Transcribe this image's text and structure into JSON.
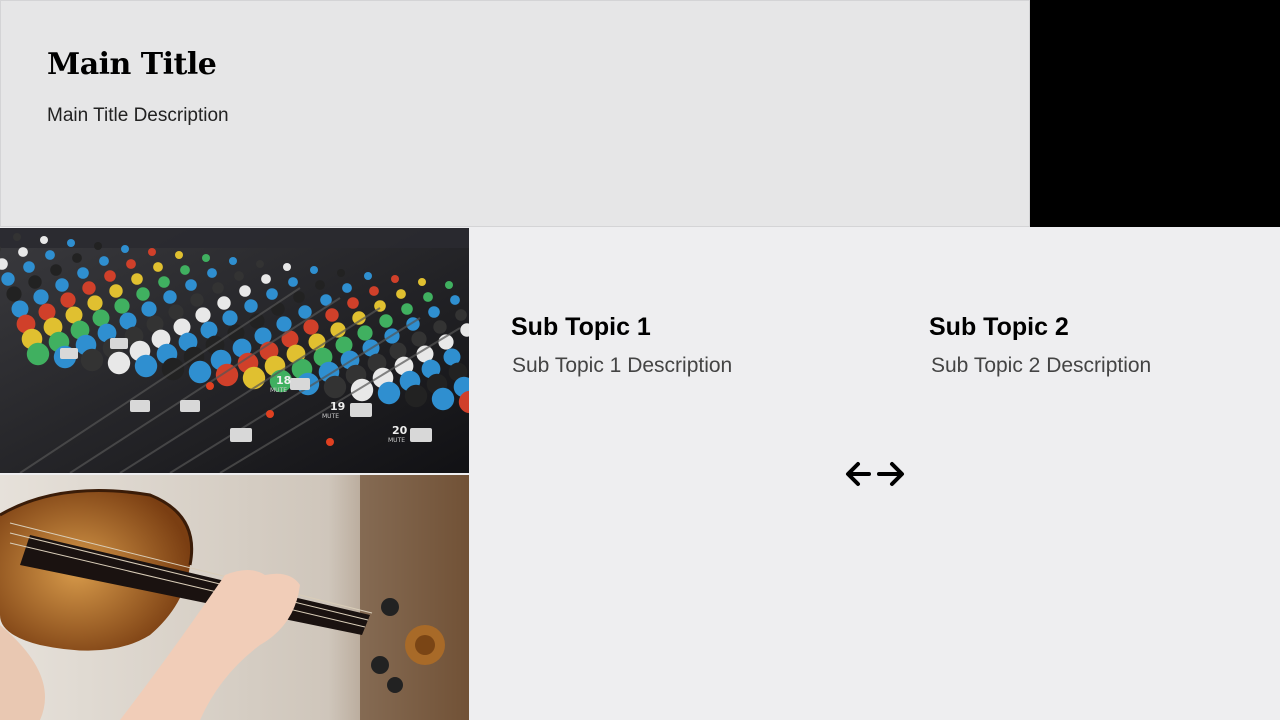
{
  "header": {
    "title": "Main Title",
    "description": "Main Title Description"
  },
  "topics": [
    {
      "title": "Sub Topic 1",
      "description": "Sub Topic 1 Description"
    },
    {
      "title": "Sub Topic 2",
      "description": "Sub Topic 2 Description"
    }
  ],
  "images": {
    "mixer": {
      "channel_labels": [
        "18",
        "19",
        "20",
        "MUTE"
      ]
    },
    "violin": {}
  },
  "icons": {
    "swap": "left-right-arrow-icon"
  },
  "colors": {
    "background": "#eeeef0",
    "header": "#e6e6e7",
    "accent_block": "#000000"
  }
}
